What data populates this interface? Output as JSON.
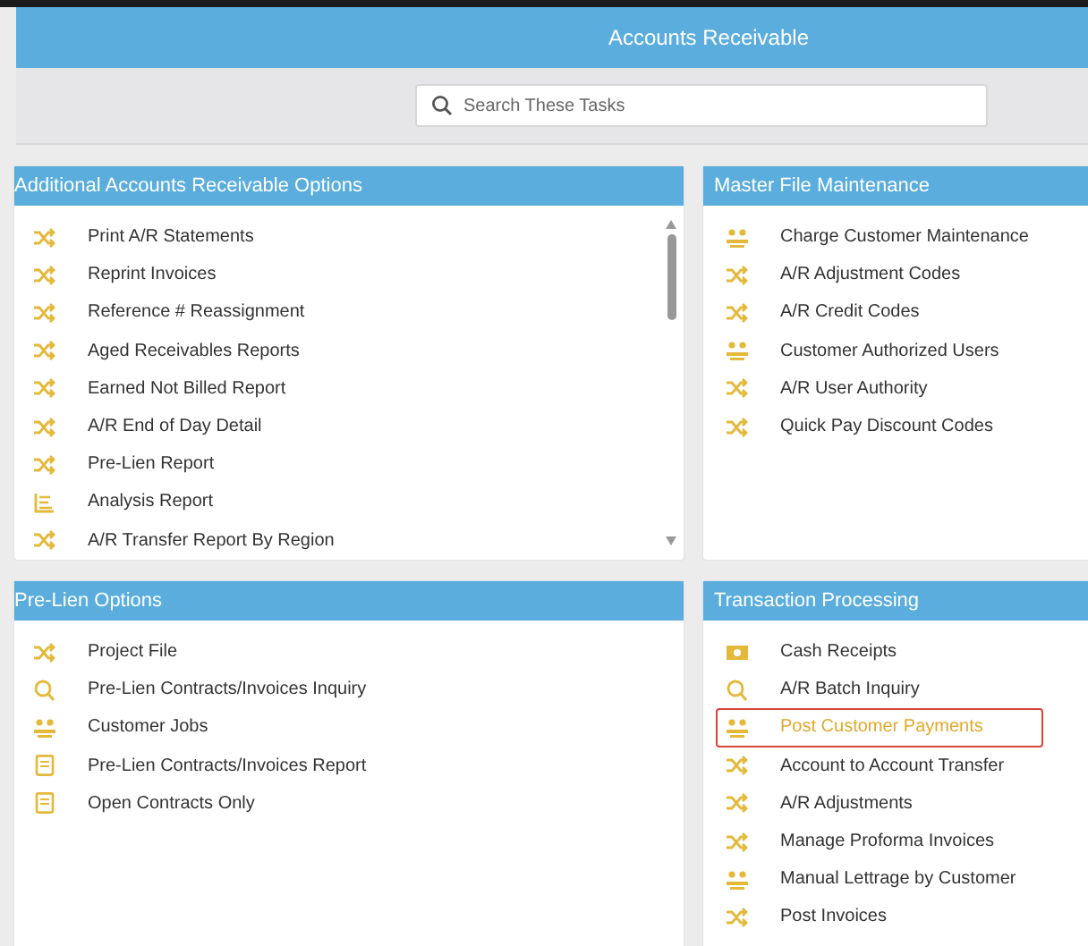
{
  "header": {
    "title": "Accounts Receivable"
  },
  "search": {
    "placeholder": "Search These Tasks"
  },
  "panels": [
    {
      "title": "Additional Accounts Receivable Options",
      "scrollable": true,
      "items": [
        {
          "label": "Print A/R Statements",
          "kind": "shuffle",
          "selected": false
        },
        {
          "label": "Reprint Invoices",
          "kind": "shuffle",
          "selected": false
        },
        {
          "label": "Reference # Reassignment",
          "kind": "shuffle",
          "selected": false
        },
        {
          "label": "Aged Receivables Reports",
          "kind": "shuffle",
          "selected": false
        },
        {
          "label": "Earned Not Billed Report",
          "kind": "shuffle",
          "selected": false
        },
        {
          "label": "A/R End of Day Detail",
          "kind": "shuffle",
          "selected": false
        },
        {
          "label": "Pre-Lien Report",
          "kind": "shuffle",
          "selected": false
        },
        {
          "label": "Analysis Report",
          "kind": "chart",
          "selected": false
        },
        {
          "label": "A/R Transfer Report By Region",
          "kind": "shuffle",
          "selected": false
        }
      ]
    },
    {
      "title": "Master File Maintenance",
      "items": [
        {
          "label": "Charge Customer Maintenance",
          "kind": "people",
          "selected": false
        },
        {
          "label": "A/R Adjustment Codes",
          "kind": "shuffle",
          "selected": false
        },
        {
          "label": "A/R Credit Codes",
          "kind": "shuffle",
          "selected": false
        },
        {
          "label": "Customer Authorized Users",
          "kind": "people",
          "selected": false
        },
        {
          "label": "A/R User Authority",
          "kind": "shuffle",
          "selected": false
        },
        {
          "label": "Quick Pay Discount Codes",
          "kind": "shuffle",
          "selected": false
        }
      ]
    },
    {
      "title": "Pre-Lien Options",
      "items": [
        {
          "label": "Project File",
          "kind": "shuffle",
          "selected": false
        },
        {
          "label": "Pre-Lien Contracts/Invoices Inquiry",
          "kind": "search",
          "selected": false
        },
        {
          "label": "Customer Jobs",
          "kind": "people",
          "selected": false
        },
        {
          "label": "Pre-Lien Contracts/Invoices Report",
          "kind": "document",
          "selected": false
        },
        {
          "label": "Open Contracts Only",
          "kind": "document",
          "selected": false
        }
      ]
    },
    {
      "title": "Transaction Processing",
      "items": [
        {
          "label": "Cash Receipts",
          "kind": "cash",
          "selected": false
        },
        {
          "label": "A/R Batch Inquiry",
          "kind": "search",
          "selected": false
        },
        {
          "label": "Post Customer Payments",
          "kind": "people",
          "selected": true
        },
        {
          "label": "Account to Account Transfer",
          "kind": "shuffle",
          "selected": false
        },
        {
          "label": "A/R Adjustments",
          "kind": "shuffle",
          "selected": false
        },
        {
          "label": "Manage Proforma Invoices",
          "kind": "shuffle",
          "selected": false
        },
        {
          "label": "Manual Lettrage by Customer",
          "kind": "people",
          "selected": false
        },
        {
          "label": "Post Invoices",
          "kind": "shuffle",
          "selected": false
        }
      ]
    }
  ]
}
